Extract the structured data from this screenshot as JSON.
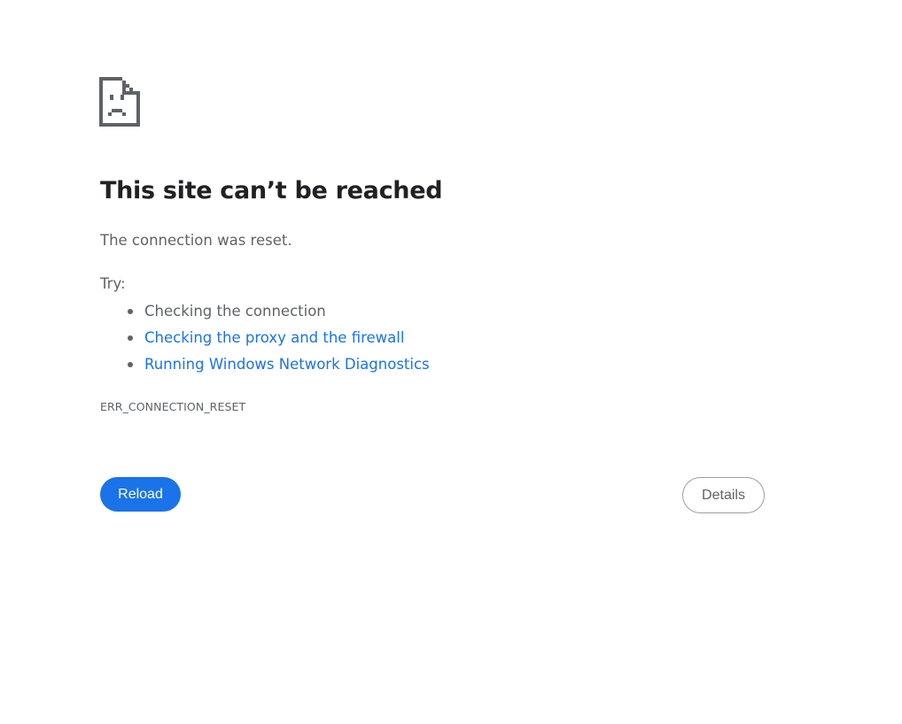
{
  "icon": "sad-page-icon",
  "title": "This site can’t be reached",
  "summary": "The connection was reset.",
  "try_label": "Try:",
  "suggestions": [
    {
      "label": "Checking the connection",
      "is_link": false
    },
    {
      "label": "Checking the proxy and the firewall",
      "is_link": true
    },
    {
      "label": "Running Windows Network Diagnostics",
      "is_link": true
    }
  ],
  "error_code": "ERR_CONNECTION_RESET",
  "buttons": {
    "reload_label": "Reload",
    "details_label": "Details"
  },
  "colors": {
    "accent": "#1a73e8",
    "heading": "#202124",
    "text": "#5f6368",
    "background": "#ffffff"
  }
}
